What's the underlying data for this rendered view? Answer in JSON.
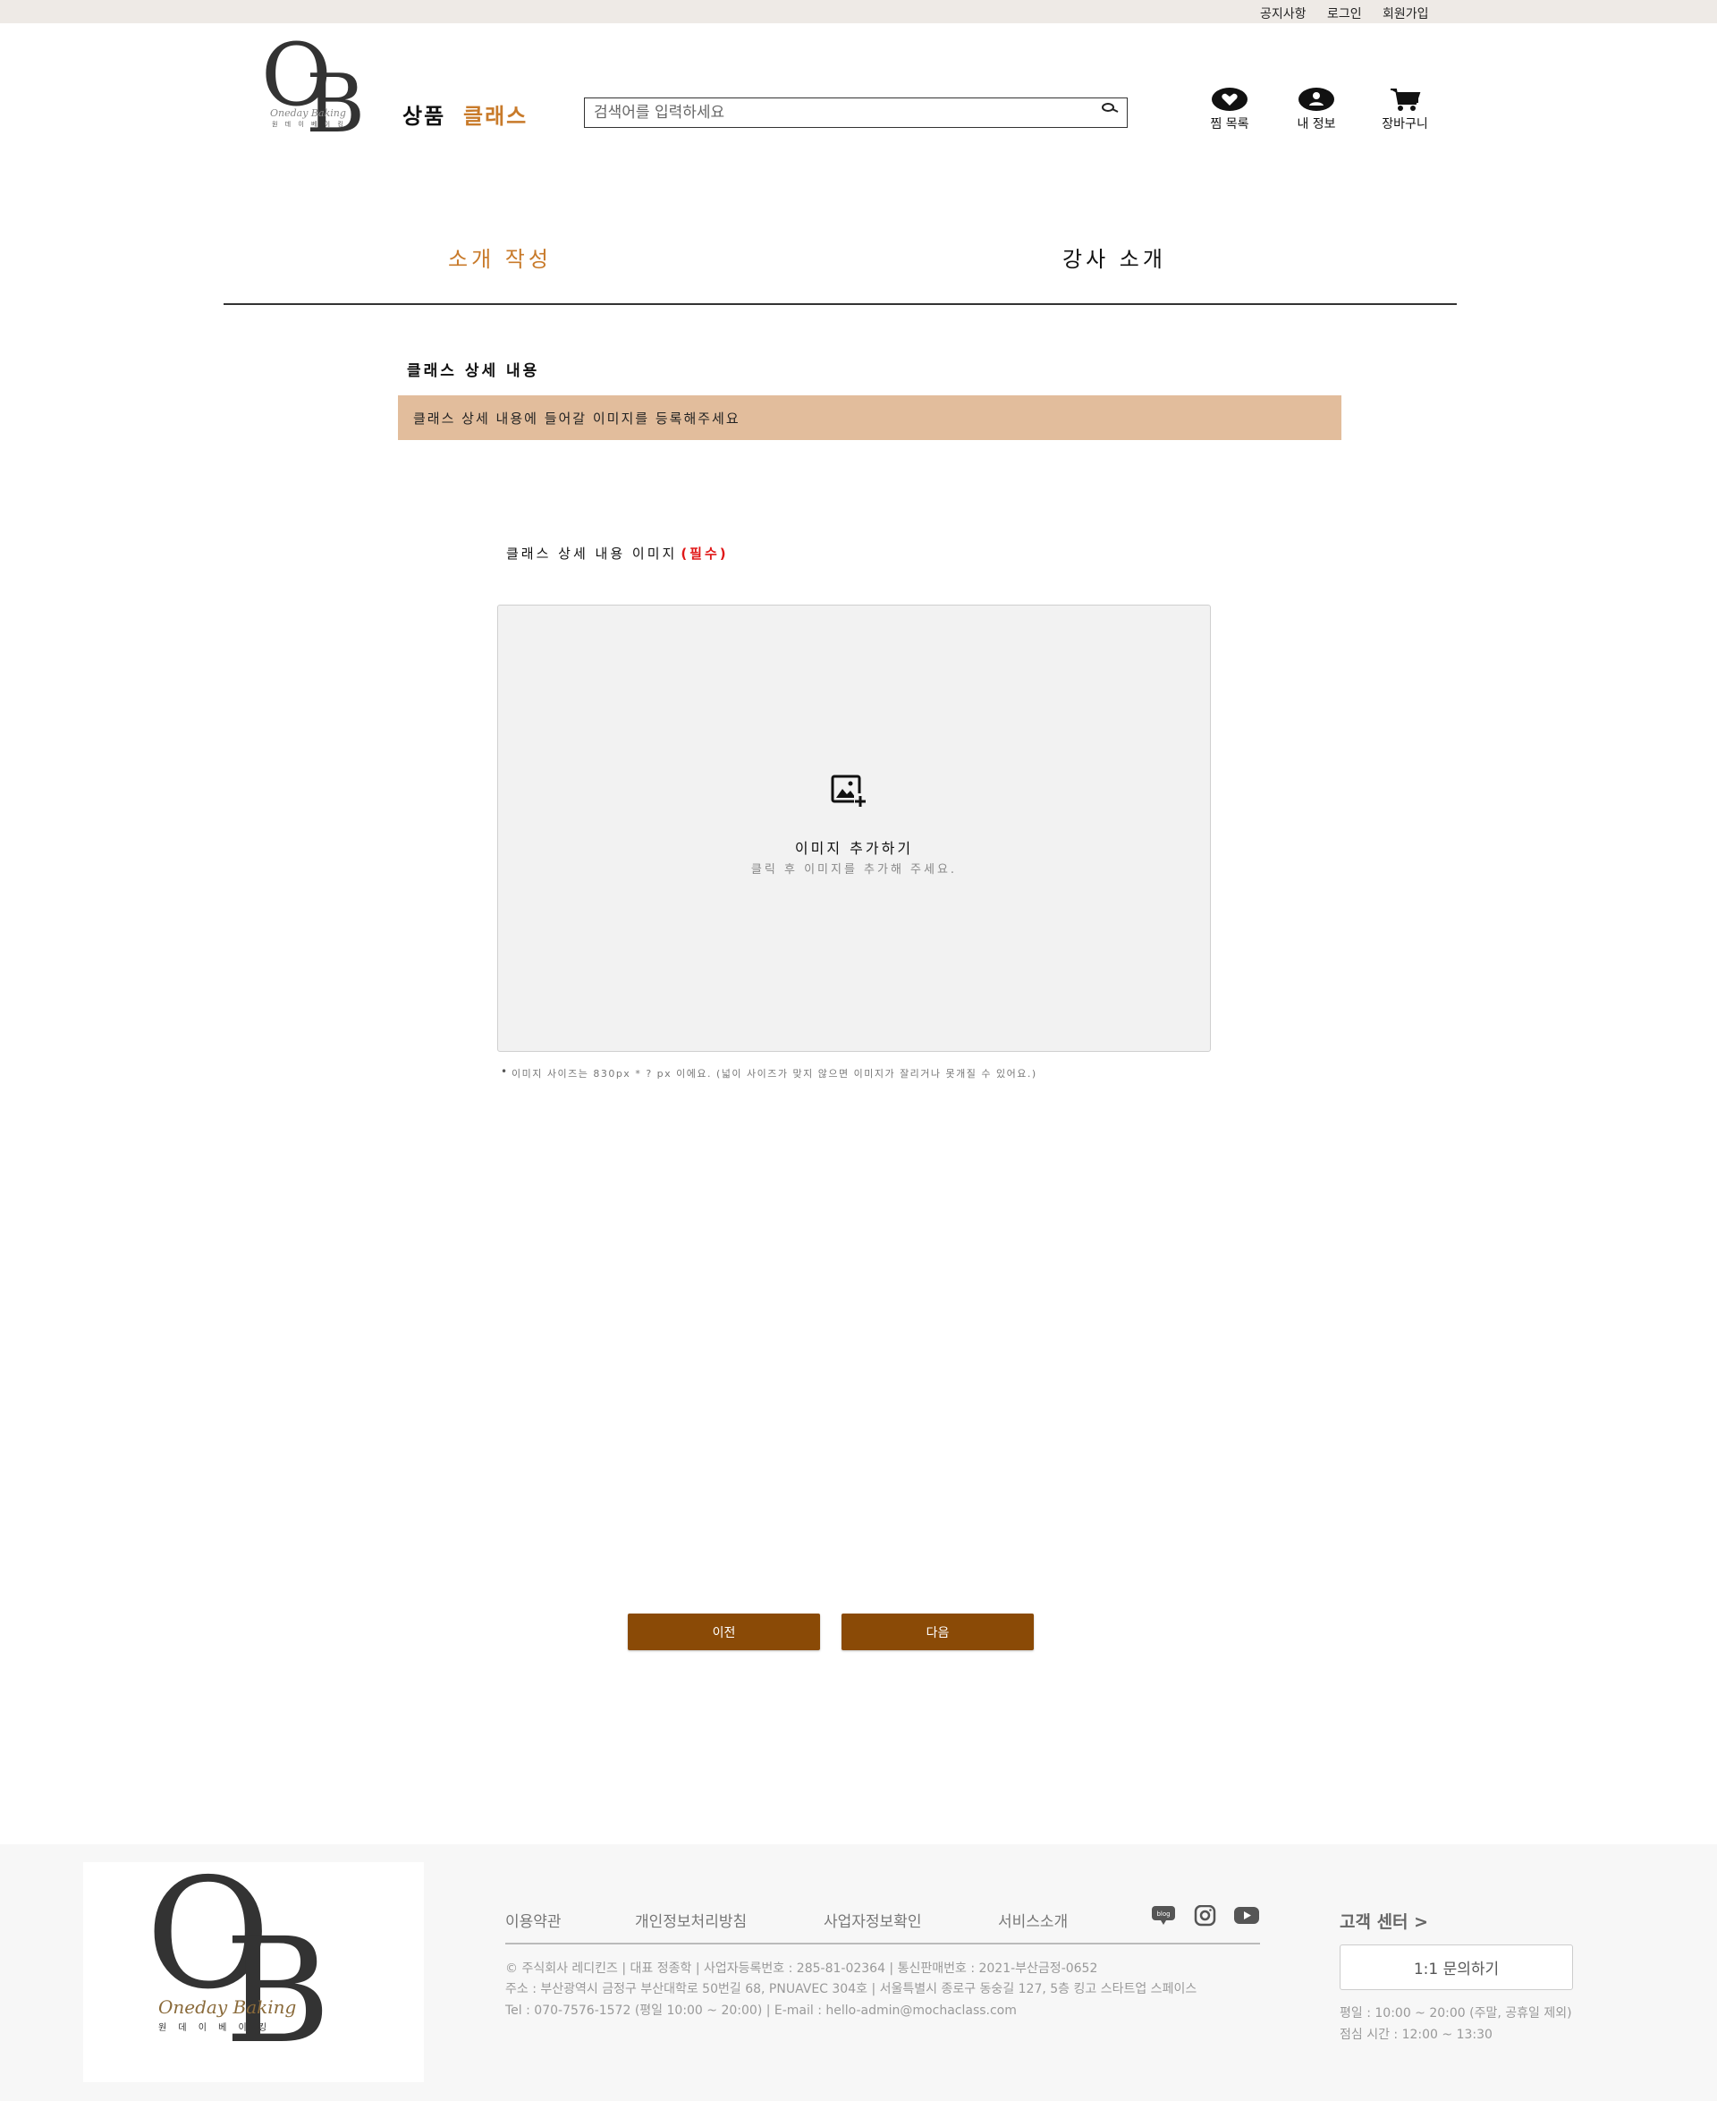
{
  "colors": {
    "accent": "#c87a2a",
    "button": "#8a4a06",
    "banner": "#e2bd9c",
    "required": "#e01818",
    "topbar": "#eeeae6"
  },
  "topbar": {
    "notice": "공지사항",
    "login": "로그인",
    "signup": "회원가입"
  },
  "logo": {
    "letters_o": "O",
    "letters_b": "B",
    "script": "Oneday Baking",
    "sub": "원 데 이 베 이 킹"
  },
  "gnb": {
    "products": "상품",
    "classes": "클래스"
  },
  "search": {
    "placeholder": "검색어를 입력하세요",
    "value": "",
    "icon": "search-icon"
  },
  "header_icons": {
    "wishlist": "찜 목록",
    "myinfo": "내 정보",
    "cart": "장바구니"
  },
  "tabs": [
    {
      "label": "소개 작성",
      "active": true
    },
    {
      "label": "강사 소개",
      "active": false
    }
  ],
  "section": {
    "title": "클래스 상세 내용",
    "banner": "클래스 상세 내용에 들어갈 이미지를 등록해주세요",
    "field_label": "클래스 상세 내용 이미지",
    "required": "(필수)",
    "upload_title": "이미지 추가하기",
    "upload_sub": "클릭 후 이미지를 추가해 주세요.",
    "note": "이미지 사이즈는 830px * ? px 이에요. (넓이 사이즈가 맞지 않으면 이미지가 잘리거나 못개질 수 있어요.)"
  },
  "buttons": {
    "prev": "이전",
    "next": "다음"
  },
  "footer": {
    "links": [
      "이용약관",
      "개인정보처리방침",
      "사업자정보확인",
      "서비스소개"
    ],
    "social": [
      "blog-icon",
      "instagram-icon",
      "youtube-icon"
    ],
    "info_line1": "© 주식회사 레디킨즈 | 대표 정종학 | 사업자등록번호 : 285-81-02364 | 통신판매번호 : 2021-부산금정-0652",
    "info_line2": "주소 : 부산광역시 금정구 부산대학로 50번길 68, PNUAVEC 304호 | 서울특별시 종로구 동숭길 127, 5층 킹고 스타트업 스페이스",
    "info_line3": "Tel : 070-7576-1572 (평일 10:00 ~ 20:00) | E-mail : hello-admin@mochaclass.com",
    "cs_title": "고객 센터 >",
    "cs_button": "1:1 문의하기",
    "cs_hours1": "평일 : 10:00 ~ 20:00 (주말, 공휴일 제외)",
    "cs_hours2": "점심 시간 : 12:00 ~ 13:30",
    "logo_script": "Oneday Baking",
    "logo_sub": "원 데 이 베 이 킹"
  }
}
